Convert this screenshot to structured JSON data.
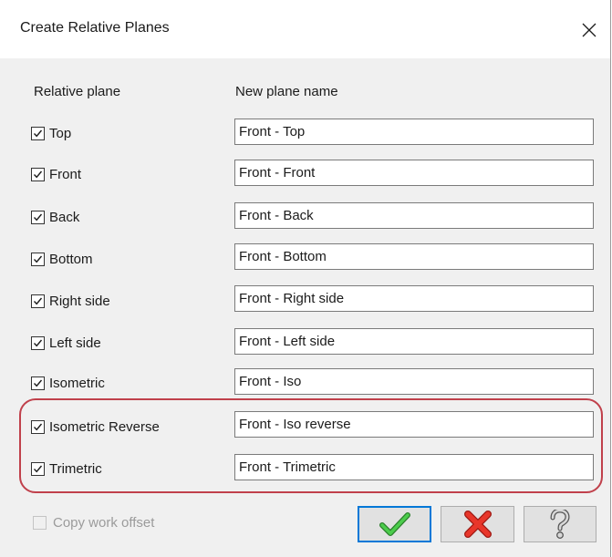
{
  "window": {
    "title": "Create Relative Planes"
  },
  "columns": {
    "relative_plane": "Relative plane",
    "new_plane_name": "New plane name"
  },
  "rows": [
    {
      "label": "Top",
      "checked": true,
      "name": "Front - Top"
    },
    {
      "label": "Front",
      "checked": true,
      "name": "Front - Front"
    },
    {
      "label": "Back",
      "checked": true,
      "name": "Front - Back"
    },
    {
      "label": "Bottom",
      "checked": true,
      "name": "Front - Bottom"
    },
    {
      "label": "Right side",
      "checked": true,
      "name": "Front - Right side"
    },
    {
      "label": "Left side",
      "checked": true,
      "name": "Front - Left side"
    },
    {
      "label": "Isometric",
      "checked": true,
      "name": "Front - Iso"
    },
    {
      "label": "Isometric Reverse",
      "checked": true,
      "name": "Front - Iso reverse"
    },
    {
      "label": "Trimetric",
      "checked": true,
      "name": "Front - Trimetric"
    }
  ],
  "copy_work_offset": {
    "label": "Copy work offset",
    "checked": false,
    "enabled": false
  },
  "buttons": {
    "ok_icon": "checkmark-icon",
    "cancel_icon": "red-x-icon",
    "help_icon": "question-mark-icon"
  },
  "colors": {
    "highlight": "#c0404b",
    "ok_check": "#3cb23c",
    "cancel_x": "#e0281e",
    "focus_border": "#0078d7"
  }
}
